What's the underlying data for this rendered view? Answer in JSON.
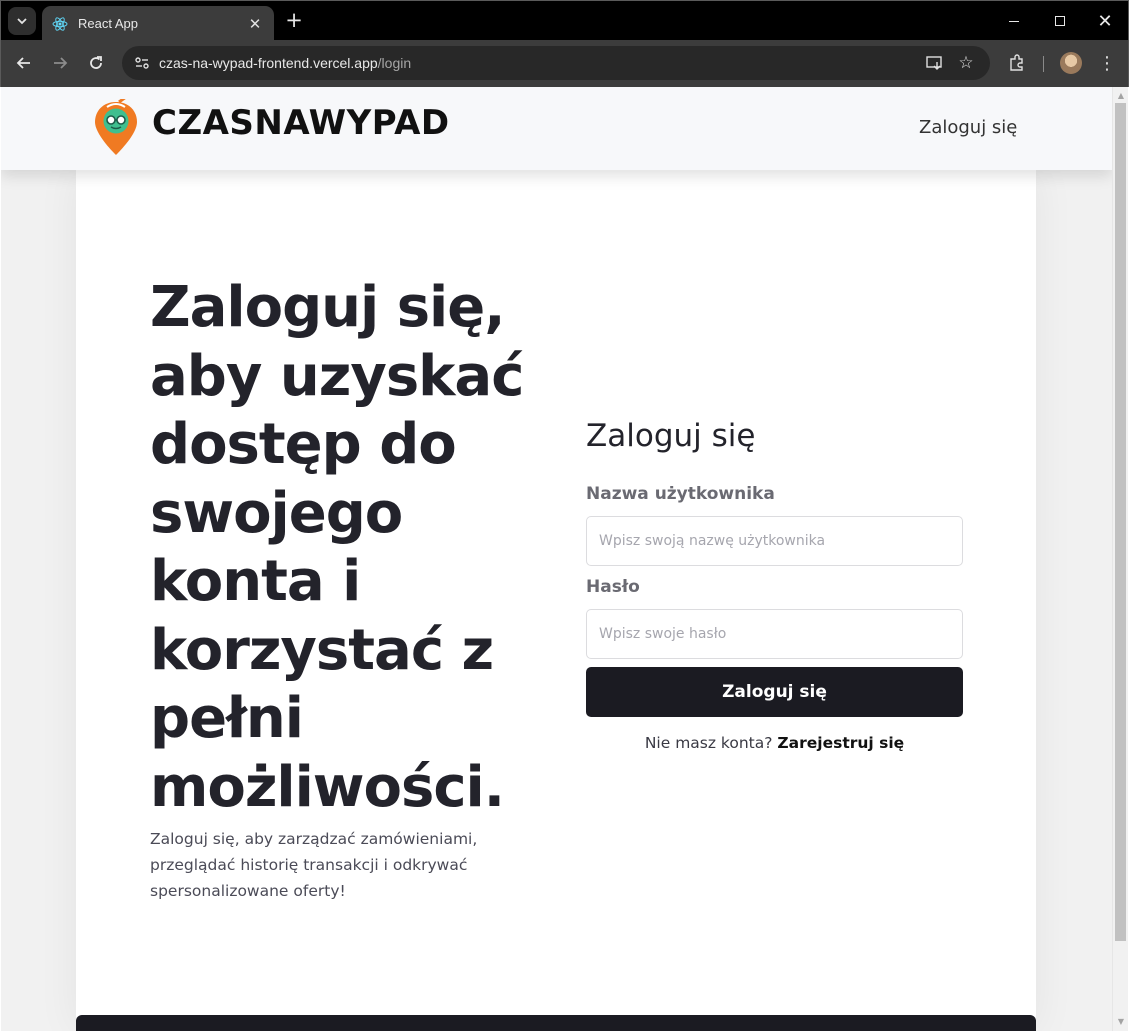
{
  "browser": {
    "tab_title": "React App",
    "url_host": "czas-na-wypad-frontend.vercel.app",
    "url_path": "/login",
    "new_tab_symbol": "+",
    "close_symbol": "✕",
    "icons": [
      "tab-search-icon",
      "react-favicon-icon",
      "back-icon",
      "forward-icon",
      "reload-icon",
      "site-info-icon",
      "install-app-icon",
      "bookmark-star-icon",
      "extensions-icon",
      "profile-avatar-icon",
      "menu-dots-icon"
    ]
  },
  "header": {
    "brand": "CZASNAWYPAD",
    "nav_login": "Zaloguj się",
    "logo_colors": {
      "pin": "#f07a22",
      "face": "#3fbf8f"
    }
  },
  "hero": {
    "title": "Zaloguj się, aby uzyskać dostęp do swojego konta i korzystać z pełni możliwości.",
    "subtitle": "Zaloguj się, aby zarządzać zamówieniami, przeglądać historię transakcji i odkrywać spersonalizowane oferty!"
  },
  "form": {
    "title": "Zaloguj się",
    "username_label": "Nazwa użytkownika",
    "username_placeholder": "Wpisz swoją nazwę użytkownika",
    "username_value": "",
    "password_label": "Hasło",
    "password_placeholder": "Wpisz swoje hasło",
    "password_value": "",
    "submit_label": "Zaloguj się",
    "signup_prompt": "Nie masz konta?",
    "signup_link": "Zarejestruj się"
  },
  "colors": {
    "primary_dark": "#1b1b22",
    "text_dark": "#23232b",
    "page_bg": "#f1f1f1"
  }
}
